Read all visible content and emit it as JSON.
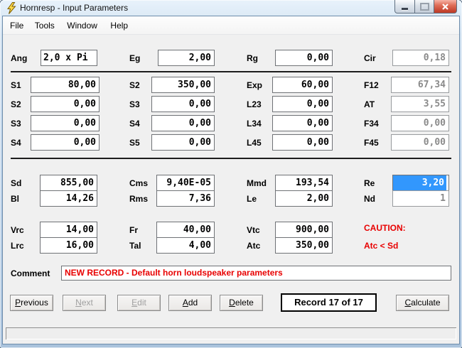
{
  "window": {
    "title": "Hornresp - Input Parameters"
  },
  "menu": {
    "items": [
      "File",
      "Tools",
      "Window",
      "Help"
    ]
  },
  "fields": {
    "ang": {
      "label": "Ang",
      "value": "2,0 x Pi"
    },
    "eg": {
      "label": "Eg",
      "value": "2,00"
    },
    "rg": {
      "label": "Rg",
      "value": "0,00"
    },
    "cir": {
      "label": "Cir",
      "value": "0,18",
      "disabled": true
    },
    "s1": {
      "label": "S1",
      "value": "80,00"
    },
    "s2b": {
      "label": "S2",
      "value": "350,00"
    },
    "exp": {
      "label": "Exp",
      "value": "60,00"
    },
    "f12": {
      "label": "F12",
      "value": "67,34",
      "disabled": true
    },
    "s2": {
      "label": "S2",
      "value": "0,00"
    },
    "s3b": {
      "label": "S3",
      "value": "0,00"
    },
    "l23": {
      "label": "L23",
      "value": "0,00"
    },
    "at": {
      "label": "AT",
      "value": "3,55",
      "disabled": true
    },
    "s3": {
      "label": "S3",
      "value": "0,00"
    },
    "s4b": {
      "label": "S4",
      "value": "0,00"
    },
    "l34": {
      "label": "L34",
      "value": "0,00"
    },
    "f34": {
      "label": "F34",
      "value": "0,00",
      "disabled": true
    },
    "s4": {
      "label": "S4",
      "value": "0,00"
    },
    "s5": {
      "label": "S5",
      "value": "0,00"
    },
    "l45": {
      "label": "L45",
      "value": "0,00"
    },
    "f45": {
      "label": "F45",
      "value": "0,00",
      "disabled": true
    },
    "sd": {
      "label": "Sd",
      "value": "855,00"
    },
    "cms": {
      "label": "Cms",
      "value": "9,40E-05"
    },
    "mmd": {
      "label": "Mmd",
      "value": "193,54"
    },
    "re": {
      "label": "Re",
      "value": "3,20",
      "selected": true
    },
    "bl": {
      "label": "Bl",
      "value": "14,26"
    },
    "rms": {
      "label": "Rms",
      "value": "7,36"
    },
    "le": {
      "label": "Le",
      "value": "2,00"
    },
    "nd": {
      "label": "Nd",
      "value": "1",
      "disabled": true
    },
    "vrc": {
      "label": "Vrc",
      "value": "14,00"
    },
    "fr": {
      "label": "Fr",
      "value": "40,00"
    },
    "vtc": {
      "label": "Vtc",
      "value": "900,00"
    },
    "lrc": {
      "label": "Lrc",
      "value": "16,00"
    },
    "tal": {
      "label": "Tal",
      "value": "4,00"
    },
    "atc": {
      "label": "Atc",
      "value": "350,00"
    }
  },
  "caution": {
    "line1": "CAUTION:",
    "line2": "Atc < Sd"
  },
  "comment": {
    "label": "Comment",
    "value": "NEW RECORD - Default horn loudspeaker parameters"
  },
  "buttons": {
    "previous": {
      "label": "Previous"
    },
    "next": {
      "label": "Next"
    },
    "edit": {
      "label": "Edit"
    },
    "add": {
      "label": "Add"
    },
    "delete": {
      "label": "Delete"
    },
    "calculate": {
      "label": "Calculate"
    }
  },
  "record_counter": "Record 17 of 17",
  "colors": {
    "selection_blue": "#3297FD",
    "warning_red": "#E80000",
    "close_button_red": "#C2402C"
  }
}
